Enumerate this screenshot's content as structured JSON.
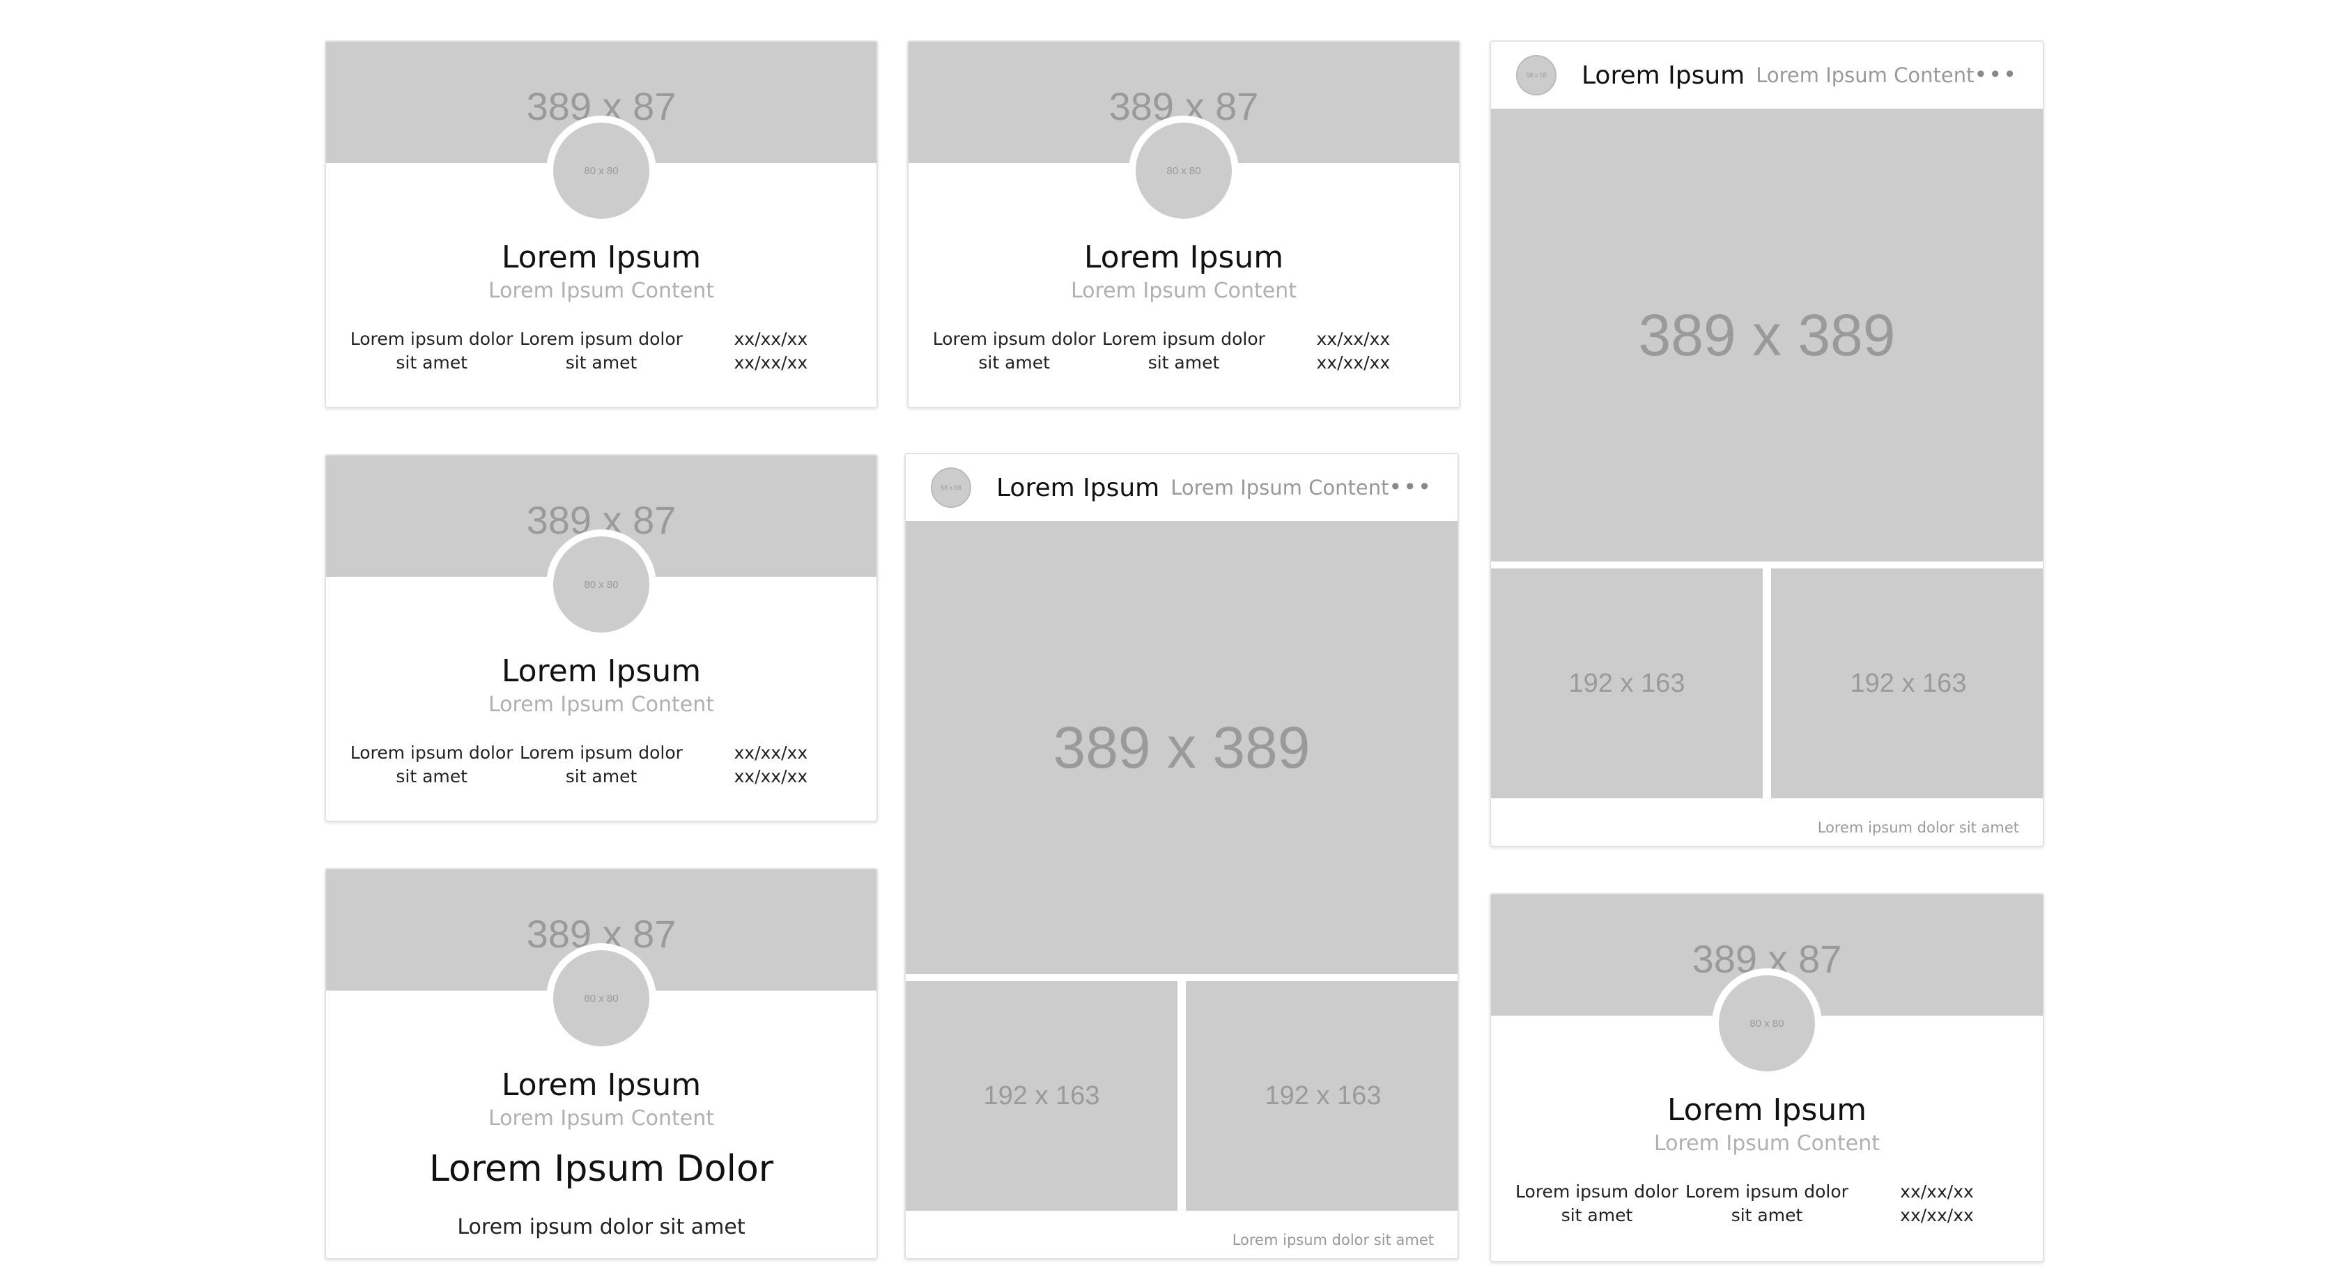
{
  "profile": {
    "banner": "389 x 87",
    "avatar": "80 x 80",
    "name": "Lorem Ipsum",
    "subtitle": "Lorem Ipsum Content",
    "stat1": "Lorem ipsum dolor sit amet",
    "stat2": "Lorem ipsum dolor sit amet",
    "date1": "xx/xx/xx",
    "date2": "xx/xx/xx"
  },
  "profile_alt": {
    "heading": "Lorem Ipsum Dolor",
    "description": "Lorem ipsum dolor sit amet"
  },
  "post": {
    "avatar": "58 x 58",
    "name": "Lorem Ipsum",
    "subtitle": "Lorem Ipsum Content",
    "more": "•••",
    "image_big": "389 x 389",
    "image_small": "192 x 163",
    "caption": "Lorem ipsum dolor sit amet"
  },
  "colors": {
    "placeholder": "#cccccc",
    "placeholder_text": "#9a9a9a",
    "border": "#e2e2e2"
  }
}
